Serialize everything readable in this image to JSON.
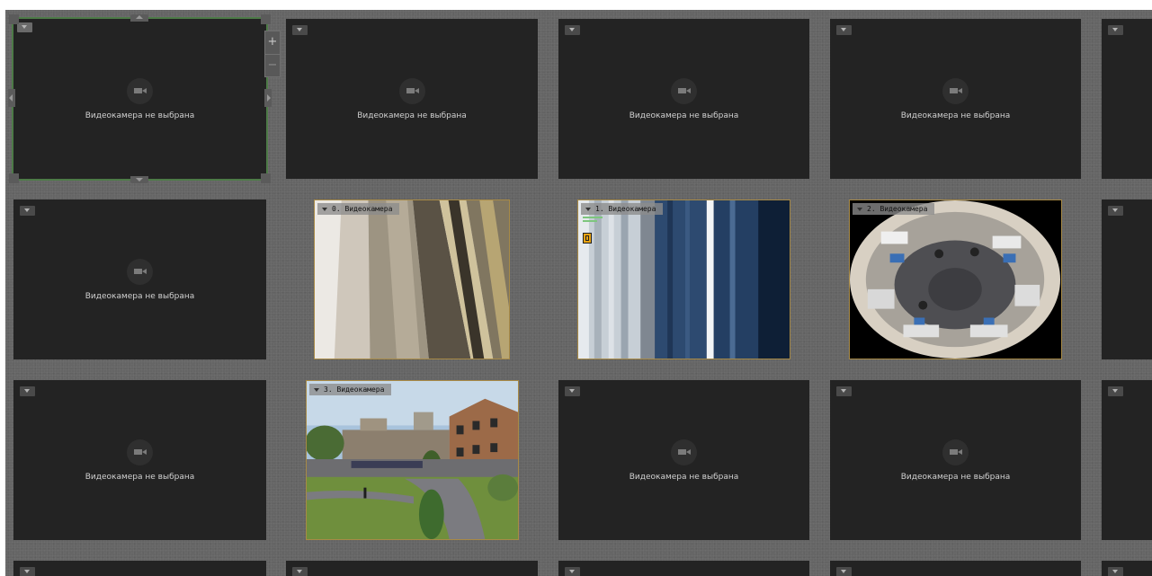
{
  "no_camera_text": "Видеокамера не выбрана",
  "zoom": {
    "plus": "+",
    "minus": "−"
  },
  "cameras": [
    {
      "label": "0. Видеокамера"
    },
    {
      "label": "1. Видеокамера"
    },
    {
      "label": "2. Видеокамера"
    },
    {
      "label": "3. Видеокамера"
    }
  ],
  "colors": {
    "empty_tile": "#232323",
    "background": "#656565",
    "selected_border": "#4d7a47",
    "video_border": "#a88a46",
    "alert_icon": "#e8a313"
  }
}
